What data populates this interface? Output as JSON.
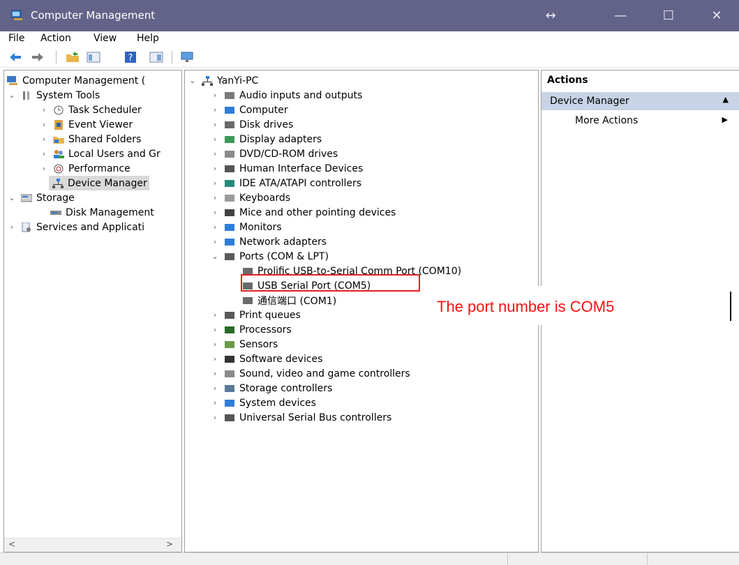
{
  "window": {
    "title": "Computer Management",
    "controls": {
      "resize": "↔",
      "minimize": "—",
      "maximize": "☐",
      "close": "✕"
    }
  },
  "menu": [
    "File",
    "Action",
    "View",
    "Help"
  ],
  "toolbar_icons": [
    "back-arrow-icon",
    "forward-arrow-icon",
    "folder-up-icon",
    "show-hide-tree-icon",
    "help-icon",
    "properties-icon",
    "monitor-icon"
  ],
  "left_tree": {
    "root": "Computer Management (",
    "system_tools": "System Tools",
    "task_scheduler": "Task Scheduler",
    "event_viewer": "Event Viewer",
    "shared_folders": "Shared Folders",
    "local_users": "Local Users and Gr",
    "performance": "Performance",
    "device_manager": "Device Manager",
    "storage": "Storage",
    "disk_management": "Disk Management",
    "services": "Services and Applicati"
  },
  "device_tree": {
    "root": "YanYi-PC",
    "categories": [
      "Audio inputs and outputs",
      "Computer",
      "Disk drives",
      "Display adapters",
      "DVD/CD-ROM drives",
      "Human Interface Devices",
      "IDE ATA/ATAPI controllers",
      "Keyboards",
      "Mice and other pointing devices",
      "Monitors",
      "Network adapters",
      "Ports (COM & LPT)"
    ],
    "ports": [
      "Prolific USB-to-Serial Comm Port (COM10)",
      "USB Serial Port (COM5)",
      "通信端口 (COM1)"
    ],
    "categories_after": [
      "Print queues",
      "Processors",
      "Sensors",
      "Software devices",
      "Sound, video and game controllers",
      "Storage controllers",
      "System devices",
      "Universal Serial Bus controllers"
    ]
  },
  "actions": {
    "header": "Actions",
    "section": "Device Manager",
    "more": "More Actions"
  },
  "annotation": "The port number is COM5",
  "colors": {
    "titlebar": "#63638a",
    "selection": "#d9d9d9",
    "actions_section": "#c8d4e6",
    "annotation": "#ff1010"
  }
}
